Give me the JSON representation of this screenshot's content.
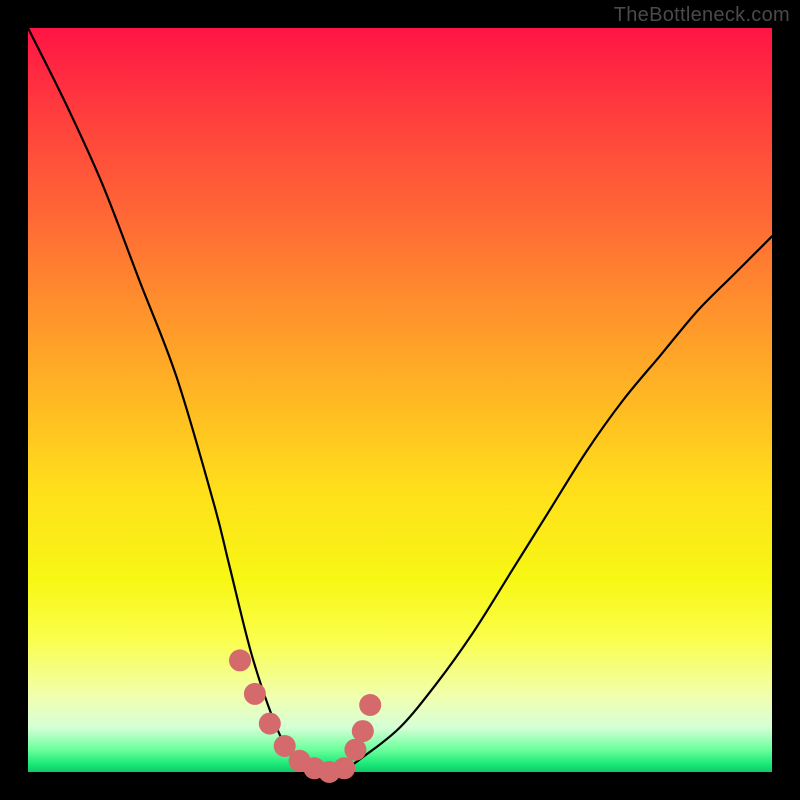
{
  "watermark": "TheBottleneck.com",
  "chart_data": {
    "type": "line",
    "title": "",
    "xlabel": "",
    "ylabel": "",
    "xlim": [
      0,
      100
    ],
    "ylim": [
      0,
      100
    ],
    "series": [
      {
        "name": "bottleneck-curve",
        "x": [
          0,
          5,
          10,
          15,
          20,
          25,
          27,
          30,
          33,
          35,
          37,
          40,
          42,
          45,
          50,
          55,
          60,
          65,
          70,
          75,
          80,
          85,
          90,
          95,
          100
        ],
        "values": [
          100,
          90,
          79,
          66,
          53,
          36,
          28,
          16,
          7,
          3,
          1,
          0,
          0,
          2,
          6,
          12,
          19,
          27,
          35,
          43,
          50,
          56,
          62,
          67,
          72
        ]
      }
    ],
    "markers": {
      "name": "highlight-points",
      "color": "#d56a6c",
      "x": [
        28.5,
        30.5,
        32.5,
        34.5,
        36.5,
        38.5,
        40.5,
        42.5,
        44.0,
        45.0,
        46.0
      ],
      "values": [
        15.0,
        10.5,
        6.5,
        3.5,
        1.5,
        0.5,
        0.0,
        0.5,
        3.0,
        5.5,
        9.0
      ]
    },
    "background_gradient": {
      "top": "#ff1445",
      "mid": "#ffdf1b",
      "bottom": "#18e876"
    }
  }
}
